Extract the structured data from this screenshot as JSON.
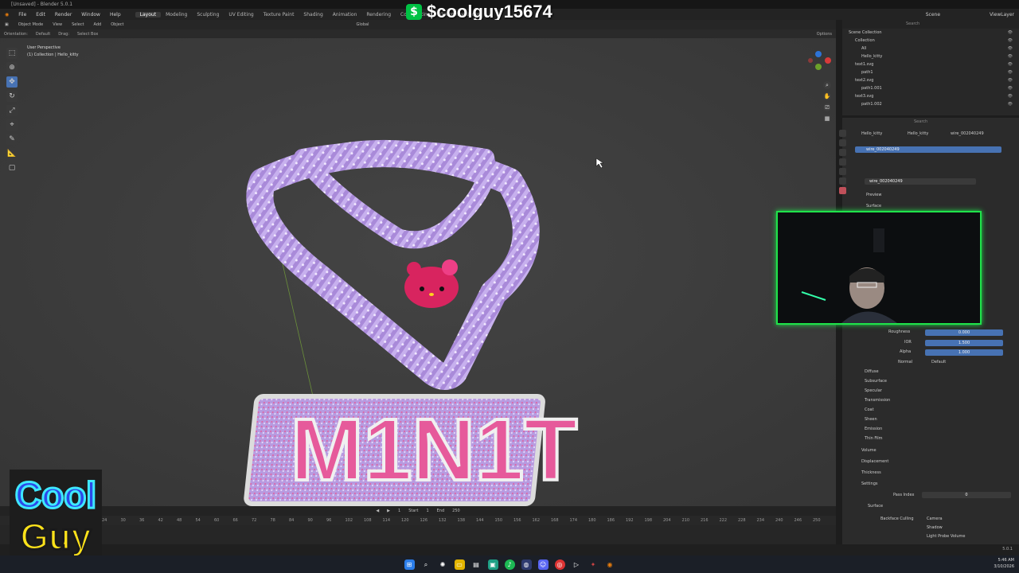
{
  "window_title": "[Unsaved] - Blender 5.0.1",
  "streamer_tag": "$coolguy15674",
  "streamer_icon": "$",
  "menus": [
    "File",
    "Edit",
    "Render",
    "Window",
    "Help"
  ],
  "workspaces": [
    "Layout",
    "Modeling",
    "Sculpting",
    "UV Editing",
    "Texture Paint",
    "Shading",
    "Animation",
    "Rendering",
    "Compositing",
    "Geometry Nodes"
  ],
  "active_workspace": "Layout",
  "scene_label": "Scene",
  "view_layer_label": "ViewLayer",
  "header3d": {
    "mode": "Object Mode",
    "menus": [
      "View",
      "Select",
      "Add",
      "Object"
    ],
    "orientation_label": "Orientation:",
    "orientation_value": "Default",
    "drag_label": "Drag:",
    "drag_value": "Select Box",
    "transform_orient": "Global",
    "options": "Options"
  },
  "viewport_info": {
    "line1": "User Perspective",
    "line2": "(1) Collection | Hello_kitty"
  },
  "scene_text": "M1N1T",
  "outliner": {
    "search_placeholder": "Search",
    "rows": [
      {
        "label": "Scene Collection",
        "indent": 0
      },
      {
        "label": "Collection",
        "indent": 1
      },
      {
        "label": "All",
        "indent": 2
      },
      {
        "label": "Hello_kitty",
        "indent": 2
      },
      {
        "label": "text1.svg",
        "indent": 1
      },
      {
        "label": "path1",
        "indent": 2
      },
      {
        "label": "text2.svg",
        "indent": 1
      },
      {
        "label": "path1.001",
        "indent": 2
      },
      {
        "label": "text3.svg",
        "indent": 1
      },
      {
        "label": "path1.002",
        "indent": 2
      }
    ]
  },
  "properties": {
    "search_placeholder": "Search",
    "breadcrumb": [
      "Hello_kitty",
      "Hello_kitty",
      "wire_002040249"
    ],
    "material_slot": "wire_002040249",
    "material_name": "wire_002040249",
    "sections": [
      "Preview",
      "Surface"
    ],
    "fields": [
      {
        "label": "Roughness",
        "value": "0.000"
      },
      {
        "label": "IOR",
        "value": "1.500"
      },
      {
        "label": "Alpha",
        "value": "1.000"
      }
    ],
    "normal_label": "Normal",
    "normal_value": "Default",
    "subsections": [
      "Diffuse",
      "Subsurface",
      "Specular",
      "Transmission",
      "Coat",
      "Sheen",
      "Emission",
      "Thin Film"
    ],
    "lower_sections": [
      "Volume",
      "Displacement",
      "Thickness",
      "Settings"
    ],
    "pass_index_label": "Pass Index",
    "pass_index_value": "0",
    "surface_label": "Surface",
    "backface_label": "Backface Culling",
    "camera_label": "Camera",
    "shadow_label": "Shadow",
    "light_probe_label": "Light Probe Volume"
  },
  "timeline": {
    "start_label": "Start",
    "start_value": "1",
    "end_label": "End",
    "end_value": "250",
    "current_frame": "1",
    "ruler": [
      "24",
      "30",
      "36",
      "42",
      "48",
      "54",
      "60",
      "66",
      "72",
      "78",
      "84",
      "90",
      "96",
      "102",
      "108",
      "114",
      "120",
      "126",
      "132",
      "138",
      "144",
      "150",
      "156",
      "162",
      "168",
      "174",
      "180",
      "186",
      "192",
      "198",
      "204",
      "210",
      "216",
      "222",
      "228",
      "234",
      "240",
      "246",
      "250"
    ]
  },
  "logo_text_1": "Cool",
  "logo_text_2": "Guy",
  "tray": {
    "time": "5:46 AM",
    "date": "3/10/2026",
    "version": "5.0.1"
  },
  "colors": {
    "accent_blue": "#4772b3",
    "chain_purple": "#a98ad9",
    "text_pink": "#e65a9b",
    "webcam_border": "#1fe34a"
  }
}
